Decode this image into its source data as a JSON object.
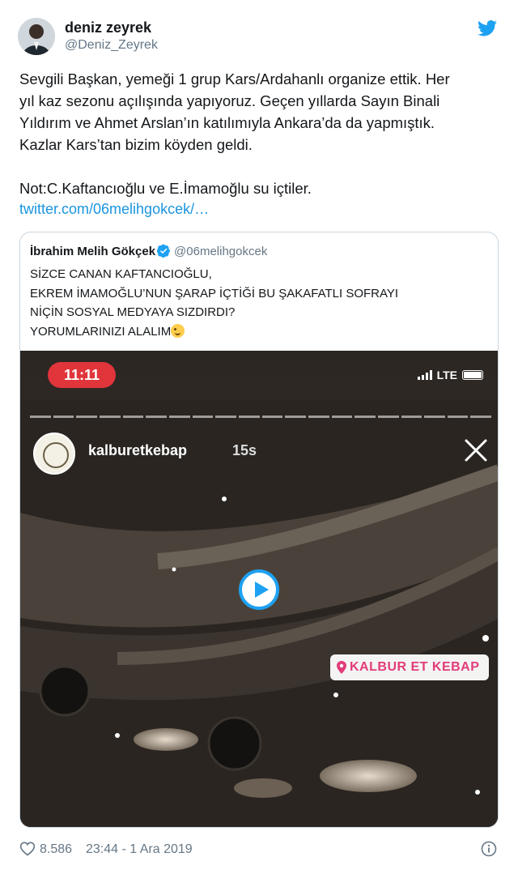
{
  "tweet": {
    "author_name": "deniz zeyrek",
    "author_handle": "@Deniz_Zeyrek",
    "text_lines": [
      "Sevgili Başkan, yemeği 1 grup Kars/Ardahanlı organize ettik. Her",
      "yıl kaz sezonu açılışında yapıyoruz. Geçen yıllarda Sayın Binali",
      "Yıldırım ve Ahmet Arslan’ın katılımıyla Ankara’da da yapmıştık.",
      "Kazlar Kars’tan bizim köyden geldi.",
      "",
      "Not:C.Kaftancıoğlu ve E.İmamoğlu su içtiler."
    ],
    "link": "twitter.com/06melihgokcek/…",
    "likes": "8.586",
    "timestamp": "23:44 - 1 Ara 2019"
  },
  "quoted": {
    "author_name": "İbrahim Melih Gökçek",
    "author_handle": "@06melihgokcek",
    "text_lines": [
      "SİZCE CANAN KAFTANCIOĞLU,",
      "EKREM İMAMOĞLU’NUN ŞARAP İÇTİĞİ BU ŞAKAFATLI SOFRAYI",
      "NİÇİN SOSYAL MEDYAYA SIZDIRDI?",
      "YORUMLARINIZI ALALIM"
    ]
  },
  "video": {
    "clock": "11:11",
    "network": "LTE",
    "story_user": "kalburetkebap",
    "story_time": "15s",
    "location_sticker": "KALBUR ET KEBAP"
  },
  "colors": {
    "link": "#1b95e0",
    "twitter_blue": "#1da1f2",
    "muted": "#657786",
    "clock_pill": "#e0353b",
    "location_text": "#e23b79"
  },
  "icons": [
    "twitter-bird-icon",
    "verified-badge-icon",
    "winking-face-icon",
    "play-icon",
    "close-icon",
    "location-pin-icon",
    "heart-icon",
    "info-icon"
  ]
}
